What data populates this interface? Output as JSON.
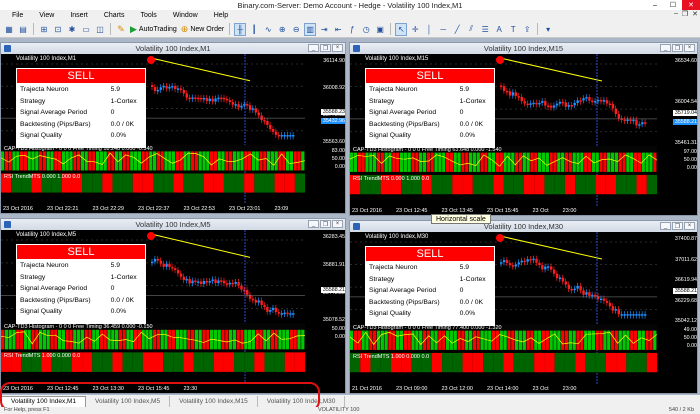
{
  "app": {
    "title": "Binary.com-Server: Demo Account - Hedge - Volatility 100 Index,M1",
    "window_controls": [
      "–",
      "☐",
      "✕"
    ]
  },
  "menu": {
    "items": [
      "File",
      "View",
      "Insert",
      "Charts",
      "Tools",
      "Window",
      "Help"
    ],
    "mdi_controls": [
      "–",
      "❐",
      "✕"
    ]
  },
  "toolbar": {
    "autotrading": "AutoTrading",
    "new_order": "New Order"
  },
  "panel": {
    "signal": "SELL",
    "rows": [
      {
        "label": "Trajecta Neuron",
        "value": "5.9"
      },
      {
        "label": "Strategy",
        "value": "1-Cortex"
      },
      {
        "label": "Signal Average Period",
        "value": "0"
      },
      {
        "label": "Backtesting (Pips/Bars)",
        "value": "0.0 / 0K"
      },
      {
        "label": "Signal Quality",
        "value": "0.0%"
      }
    ]
  },
  "windows": [
    {
      "title": "Volatility 100 Index,M1",
      "symbol": "Volatility 100 Index,M1",
      "prices": [
        "36114.90",
        "36008.92",
        "35775.93",
        "35563.60"
      ],
      "price_boxes": [
        "35588.23",
        "35432.96"
      ],
      "ind1": "CAP-TD3 Histogram - 0 0 0 Free Timing 18.248 0.000 -0.340",
      "ind2": "RSI TrendMTS 0.000 1.000 0.0",
      "ind_scale": [
        "83.00",
        "50.00",
        "0.00"
      ],
      "dates": [
        "23 Oct 2016",
        "23 Oct 22:21",
        "23 Oct 22:29",
        "23 Oct 22:37",
        "23 Oct 22:53",
        "23 Oct 23:01",
        "23:09"
      ]
    },
    {
      "title": "Volatility 100 Index,M15",
      "symbol": "Volatility 100 Index,M15",
      "prices": [
        "36534.60",
        "36004.54",
        "35461.31"
      ],
      "price_boxes": [
        "35719.04",
        "35588.21"
      ],
      "ind1": "CAP-TD3 Histogram - 0 0 0 Free Timing 63.648 0.000 -1.540",
      "ind2": "RSI TrendMTS 0.000 1.000 0.0",
      "ind_scale": [
        "97.00",
        "50.00",
        "0.00"
      ],
      "dates": [
        "23 Oct 2016",
        "23 Oct 12:45",
        "23 Oct 13:45",
        "23 Oct 15:45",
        "23 Oct",
        "23:00"
      ]
    },
    {
      "title": "Volatility 100 Index,M5",
      "symbol": "Volatility 100 Index,M5",
      "prices": [
        "36283.45",
        "35881.91",
        "35443.22",
        "35078.52"
      ],
      "price_boxes": [
        "35588.21"
      ],
      "ind1": "CAP-TD3 Histogram - 0 0 0 Free Timing 36.459 0.000 -0.150",
      "ind2": "RSI TrendMTS 1.000 0.000 0.0",
      "ind_scale": [
        "50.00",
        "0.00"
      ],
      "dates": [
        "23 Oct 2016",
        "23 Oct 12:45",
        "23 Oct 13:30",
        "23 Oct 15:45",
        "23:30"
      ]
    },
    {
      "title": "Volatility 100 Index,M30",
      "symbol": "Volatility 100 Index,M30",
      "prices": [
        "37400.87",
        "37011.62",
        "36619.94",
        "36229.68",
        "35042.12"
      ],
      "price_boxes": [
        "35588.21"
      ],
      "ind1": "CAP-TD3 Histogram - 0 0 0 Free Timing 77.400 0.000 -1.320",
      "ind2": "RSI TrendMTS 1.000 0.000 0.0",
      "ind_scale": [
        "49.00",
        "50.00",
        "0.00"
      ],
      "dates": [
        "21 Oct 2016",
        "23 Oct 09:00",
        "23 Oct 12:00",
        "23 Oct 14:00",
        "23 Oct",
        "23:00"
      ]
    }
  ],
  "tooltip": "Horizontal scale",
  "tabs": [
    "Volatility 100 Index,M1",
    "Volatility 100 Index,M5",
    "Volatility 100 Index,M15",
    "Volatility 100 Index,M30"
  ],
  "status": {
    "left": "For Help, press F1",
    "mid": "VOLATILITY 100",
    "right": "540 / 2 Kb"
  },
  "colors": {
    "sell": "#ff0000",
    "trend": "#ffff00",
    "bull": "#1e90ff",
    "bear": "#ff1e1e",
    "hist_green": "#00c800",
    "hist_red": "#ff0000"
  }
}
